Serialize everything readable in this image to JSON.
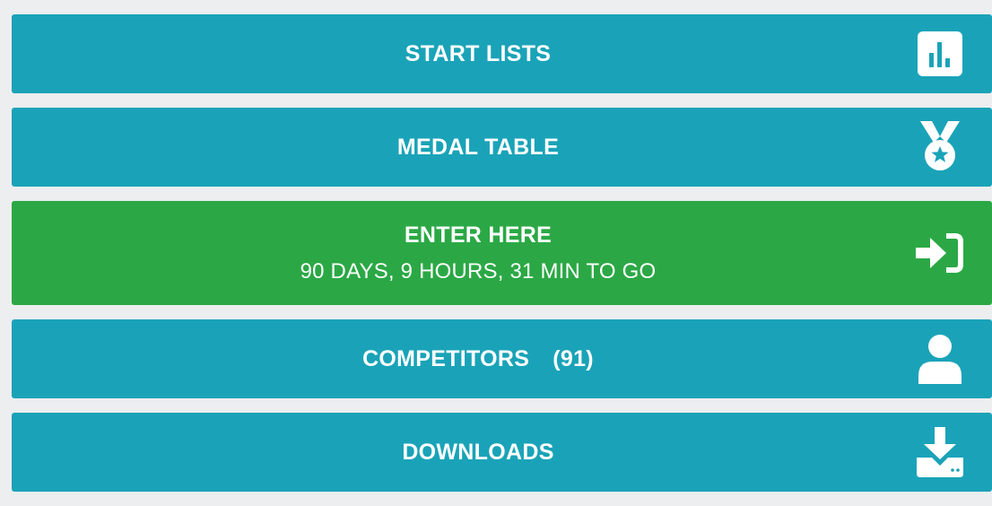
{
  "menu": {
    "start_lists": {
      "label": "START LISTS",
      "icon": "bar-chart-icon"
    },
    "medal_table": {
      "label": "MEDAL TABLE",
      "icon": "medal-icon"
    },
    "enter_here": {
      "label": "ENTER HERE",
      "countdown": "90 DAYS, 9 HOURS, 31 MIN TO GO",
      "icon": "sign-in-icon"
    },
    "competitors": {
      "label": "COMPETITORS",
      "count": "(91)",
      "icon": "user-icon"
    },
    "downloads": {
      "label": "DOWNLOADS",
      "icon": "download-icon"
    }
  },
  "colors": {
    "primary": "#1aa3b8",
    "success": "#2ba845",
    "background": "#eceef0",
    "text": "#ffffff"
  }
}
